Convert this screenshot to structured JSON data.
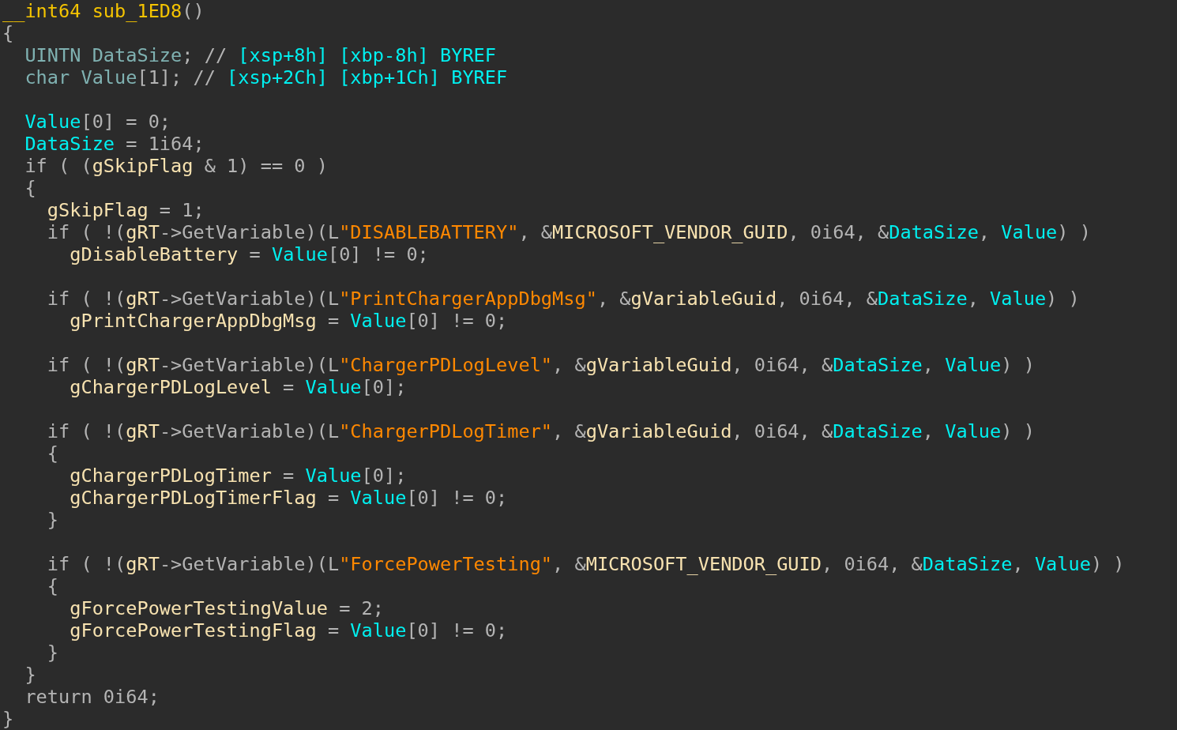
{
  "code_view": {
    "lines": [
      {
        "kind": "code",
        "tokens": [
          {
            "kind": "function",
            "text": "__int64 sub_1ED8"
          },
          {
            "kind": "plain",
            "text": "()"
          }
        ]
      },
      {
        "kind": "code",
        "tokens": [
          {
            "kind": "plain",
            "text": "{"
          }
        ],
        "children": [
          {
            "kind": "code",
            "tokens": [
              {
                "kind": "declaration",
                "text": "UINTN DataSize"
              },
              {
                "kind": "plain",
                "text": "; // "
              },
              {
                "kind": "comment",
                "text": "[xsp+8h] [xbp-8h] BYREF"
              }
            ]
          },
          {
            "kind": "code",
            "tokens": [
              {
                "kind": "declaration",
                "text": "char Value"
              },
              {
                "kind": "plain",
                "text": "[1]; // "
              },
              {
                "kind": "comment",
                "text": "[xsp+2Ch] [xbp+1Ch] BYREF"
              }
            ]
          },
          {
            "kind": "blank"
          },
          {
            "kind": "code",
            "tokens": [
              {
                "kind": "local",
                "text": "Value"
              },
              {
                "kind": "plain",
                "text": "[0] = 0;"
              }
            ]
          },
          {
            "kind": "code",
            "tokens": [
              {
                "kind": "local",
                "text": "DataSize"
              },
              {
                "kind": "plain",
                "text": " = 1i64;"
              }
            ]
          },
          {
            "kind": "code",
            "tokens": [
              {
                "kind": "plain",
                "text": "if ( ("
              },
              {
                "kind": "global",
                "text": "gSkipFlag"
              },
              {
                "kind": "plain",
                "text": " & 1) == 0 )"
              }
            ]
          },
          {
            "kind": "code",
            "tokens": [
              {
                "kind": "plain",
                "text": "{"
              }
            ],
            "children": [
              {
                "kind": "code",
                "tokens": [
                  {
                    "kind": "global",
                    "text": "gSkipFlag"
                  },
                  {
                    "kind": "plain",
                    "text": " = 1;"
                  }
                ]
              },
              {
                "kind": "code",
                "tokens": [
                  {
                    "kind": "plain",
                    "text": "if ( !("
                  },
                  {
                    "kind": "global",
                    "text": "gRT"
                  },
                  {
                    "kind": "plain",
                    "text": "->GetVariable)(L"
                  },
                  {
                    "kind": "string",
                    "text": "\"DISABLEBATTERY\""
                  },
                  {
                    "kind": "plain",
                    "text": ", &"
                  },
                  {
                    "kind": "global",
                    "text": "MICROSOFT_VENDOR_GUID"
                  },
                  {
                    "kind": "plain",
                    "text": ", 0i64, &"
                  },
                  {
                    "kind": "local",
                    "text": "DataSize"
                  },
                  {
                    "kind": "plain",
                    "text": ", "
                  },
                  {
                    "kind": "local",
                    "text": "Value"
                  },
                  {
                    "kind": "plain",
                    "text": ") )"
                  }
                ],
                "children": [
                  {
                    "kind": "code",
                    "tokens": [
                      {
                        "kind": "global",
                        "text": "gDisableBattery"
                      },
                      {
                        "kind": "plain",
                        "text": " = "
                      },
                      {
                        "kind": "local",
                        "text": "Value"
                      },
                      {
                        "kind": "plain",
                        "text": "[0] != 0;"
                      }
                    ]
                  }
                ]
              },
              {
                "kind": "blank"
              },
              {
                "kind": "code",
                "tokens": [
                  {
                    "kind": "plain",
                    "text": "if ( !("
                  },
                  {
                    "kind": "global",
                    "text": "gRT"
                  },
                  {
                    "kind": "plain",
                    "text": "->GetVariable)(L"
                  },
                  {
                    "kind": "string",
                    "text": "\"PrintChargerAppDbgMsg\""
                  },
                  {
                    "kind": "plain",
                    "text": ", &"
                  },
                  {
                    "kind": "global",
                    "text": "gVariableGuid"
                  },
                  {
                    "kind": "plain",
                    "text": ", 0i64, &"
                  },
                  {
                    "kind": "local",
                    "text": "DataSize"
                  },
                  {
                    "kind": "plain",
                    "text": ", "
                  },
                  {
                    "kind": "local",
                    "text": "Value"
                  },
                  {
                    "kind": "plain",
                    "text": ") )"
                  }
                ],
                "children": [
                  {
                    "kind": "code",
                    "tokens": [
                      {
                        "kind": "global",
                        "text": "gPrintChargerAppDbgMsg"
                      },
                      {
                        "kind": "plain",
                        "text": " = "
                      },
                      {
                        "kind": "local",
                        "text": "Value"
                      },
                      {
                        "kind": "plain",
                        "text": "[0] != 0;"
                      }
                    ]
                  }
                ]
              },
              {
                "kind": "blank"
              },
              {
                "kind": "code",
                "tokens": [
                  {
                    "kind": "plain",
                    "text": "if ( !("
                  },
                  {
                    "kind": "global",
                    "text": "gRT"
                  },
                  {
                    "kind": "plain",
                    "text": "->GetVariable)(L"
                  },
                  {
                    "kind": "string",
                    "text": "\"ChargerPDLogLevel\""
                  },
                  {
                    "kind": "plain",
                    "text": ", &"
                  },
                  {
                    "kind": "global",
                    "text": "gVariableGuid"
                  },
                  {
                    "kind": "plain",
                    "text": ", 0i64, &"
                  },
                  {
                    "kind": "local",
                    "text": "DataSize"
                  },
                  {
                    "kind": "plain",
                    "text": ", "
                  },
                  {
                    "kind": "local",
                    "text": "Value"
                  },
                  {
                    "kind": "plain",
                    "text": ") )"
                  }
                ],
                "children": [
                  {
                    "kind": "code",
                    "tokens": [
                      {
                        "kind": "global",
                        "text": "gChargerPDLogLevel"
                      },
                      {
                        "kind": "plain",
                        "text": " = "
                      },
                      {
                        "kind": "local",
                        "text": "Value"
                      },
                      {
                        "kind": "plain",
                        "text": "[0];"
                      }
                    ]
                  }
                ]
              },
              {
                "kind": "blank"
              },
              {
                "kind": "code",
                "tokens": [
                  {
                    "kind": "plain",
                    "text": "if ( !("
                  },
                  {
                    "kind": "global",
                    "text": "gRT"
                  },
                  {
                    "kind": "plain",
                    "text": "->GetVariable)(L"
                  },
                  {
                    "kind": "string",
                    "text": "\"ChargerPDLogTimer\""
                  },
                  {
                    "kind": "plain",
                    "text": ", &"
                  },
                  {
                    "kind": "global",
                    "text": "gVariableGuid"
                  },
                  {
                    "kind": "plain",
                    "text": ", 0i64, &"
                  },
                  {
                    "kind": "local",
                    "text": "DataSize"
                  },
                  {
                    "kind": "plain",
                    "text": ", "
                  },
                  {
                    "kind": "local",
                    "text": "Value"
                  },
                  {
                    "kind": "plain",
                    "text": ") )"
                  }
                ]
              },
              {
                "kind": "code",
                "tokens": [
                  {
                    "kind": "plain",
                    "text": "{"
                  }
                ],
                "children": [
                  {
                    "kind": "code",
                    "tokens": [
                      {
                        "kind": "global",
                        "text": "gChargerPDLogTimer"
                      },
                      {
                        "kind": "plain",
                        "text": " = "
                      },
                      {
                        "kind": "local",
                        "text": "Value"
                      },
                      {
                        "kind": "plain",
                        "text": "[0];"
                      }
                    ]
                  },
                  {
                    "kind": "code",
                    "tokens": [
                      {
                        "kind": "global",
                        "text": "gChargerPDLogTimerFlag"
                      },
                      {
                        "kind": "plain",
                        "text": " = "
                      },
                      {
                        "kind": "local",
                        "text": "Value"
                      },
                      {
                        "kind": "plain",
                        "text": "[0] != 0;"
                      }
                    ]
                  }
                ]
              },
              {
                "kind": "code",
                "tokens": [
                  {
                    "kind": "plain",
                    "text": "}"
                  }
                ]
              },
              {
                "kind": "blank"
              },
              {
                "kind": "code",
                "tokens": [
                  {
                    "kind": "plain",
                    "text": "if ( !("
                  },
                  {
                    "kind": "global",
                    "text": "gRT"
                  },
                  {
                    "kind": "plain",
                    "text": "->GetVariable)(L"
                  },
                  {
                    "kind": "string",
                    "text": "\"ForcePowerTesting\""
                  },
                  {
                    "kind": "plain",
                    "text": ", &"
                  },
                  {
                    "kind": "global",
                    "text": "MICROSOFT_VENDOR_GUID"
                  },
                  {
                    "kind": "plain",
                    "text": ", 0i64, &"
                  },
                  {
                    "kind": "local",
                    "text": "DataSize"
                  },
                  {
                    "kind": "plain",
                    "text": ", "
                  },
                  {
                    "kind": "local",
                    "text": "Value"
                  },
                  {
                    "kind": "plain",
                    "text": ") )"
                  }
                ]
              },
              {
                "kind": "code",
                "tokens": [
                  {
                    "kind": "plain",
                    "text": "{"
                  }
                ],
                "children": [
                  {
                    "kind": "code",
                    "tokens": [
                      {
                        "kind": "global",
                        "text": "gForcePowerTestingValue"
                      },
                      {
                        "kind": "plain",
                        "text": " = 2;"
                      }
                    ]
                  },
                  {
                    "kind": "code",
                    "tokens": [
                      {
                        "kind": "global",
                        "text": "gForcePowerTestingFlag"
                      },
                      {
                        "kind": "plain",
                        "text": " = "
                      },
                      {
                        "kind": "local",
                        "text": "Value"
                      },
                      {
                        "kind": "plain",
                        "text": "[0] != 0;"
                      }
                    ]
                  }
                ]
              },
              {
                "kind": "code",
                "tokens": [
                  {
                    "kind": "plain",
                    "text": "}"
                  }
                ]
              }
            ]
          },
          {
            "kind": "code",
            "tokens": [
              {
                "kind": "plain",
                "text": "}"
              }
            ]
          },
          {
            "kind": "code",
            "tokens": [
              {
                "kind": "plain",
                "text": "return 0i64;"
              }
            ]
          }
        ]
      },
      {
        "kind": "code",
        "tokens": [
          {
            "kind": "plain",
            "text": "}"
          }
        ]
      }
    ]
  }
}
